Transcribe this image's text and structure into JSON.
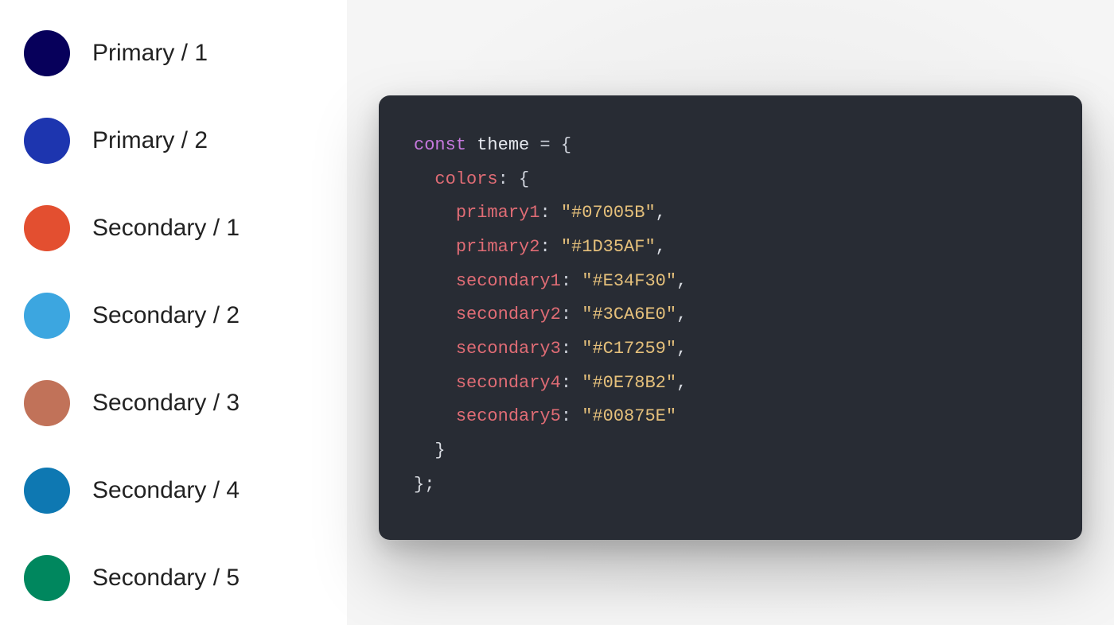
{
  "palette": [
    {
      "label": "Primary / 1",
      "hex": "#07005B"
    },
    {
      "label": "Primary / 2",
      "hex": "#1D35AF"
    },
    {
      "label": "Secondary / 1",
      "hex": "#E34F30"
    },
    {
      "label": "Secondary / 2",
      "hex": "#3CA6E0"
    },
    {
      "label": "Secondary / 3",
      "hex": "#C17259"
    },
    {
      "label": "Secondary / 4",
      "hex": "#0E78B2"
    },
    {
      "label": "Secondary / 5",
      "hex": "#00875E"
    }
  ],
  "code": {
    "kw_const": "const",
    "var_name": "theme",
    "eq_open": " = {",
    "colors_key": "colors",
    "colon_open": ": {",
    "entries": [
      {
        "key": "primary1",
        "val": "\"#07005B\"",
        "comma": ","
      },
      {
        "key": "primary2",
        "val": "\"#1D35AF\"",
        "comma": ","
      },
      {
        "key": "secondary1",
        "val": "\"#E34F30\"",
        "comma": ","
      },
      {
        "key": "secondary2",
        "val": "\"#3CA6E0\"",
        "comma": ","
      },
      {
        "key": "secondary3",
        "val": "\"#C17259\"",
        "comma": ","
      },
      {
        "key": "secondary4",
        "val": "\"#0E78B2\"",
        "comma": ","
      },
      {
        "key": "secondary5",
        "val": "\"#00875E\"",
        "comma": ""
      }
    ],
    "close_inner": "}",
    "close_outer": "};"
  }
}
